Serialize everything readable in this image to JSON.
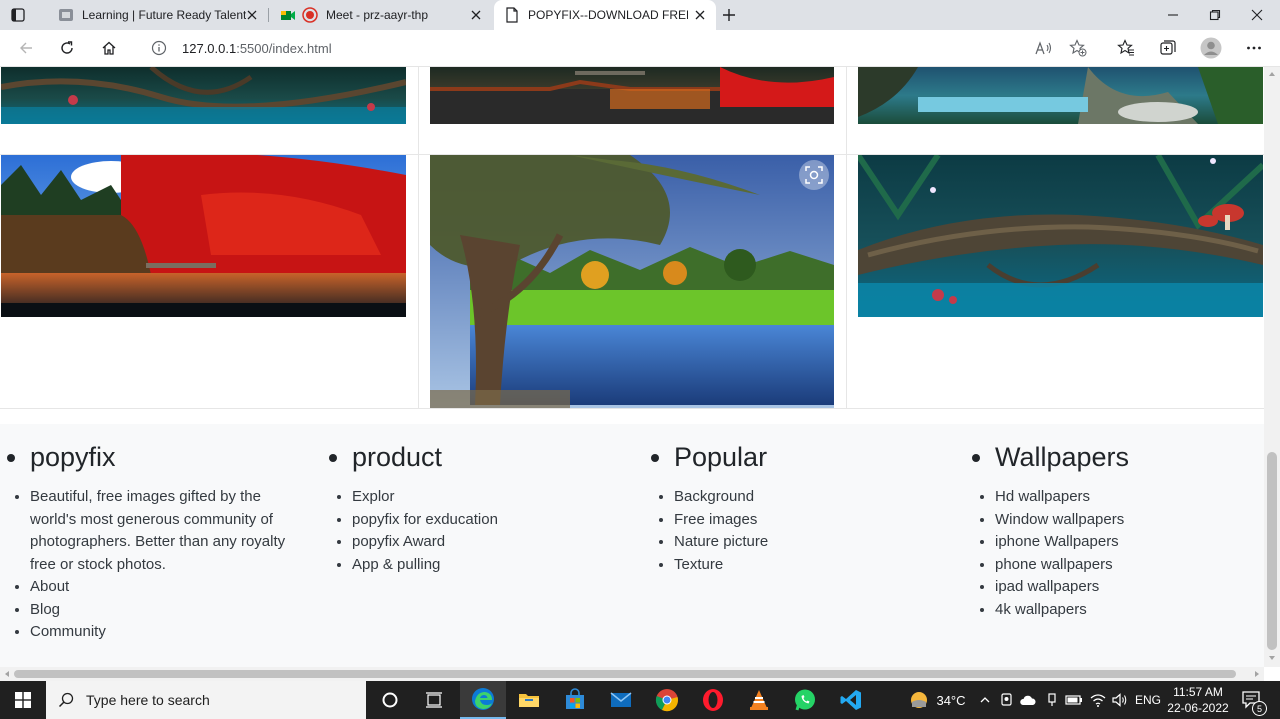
{
  "browser": {
    "tabs": [
      {
        "title": "Learning | Future Ready Talent",
        "active": false
      },
      {
        "title": "Meet - prz-aayr-thp",
        "active": false
      },
      {
        "title": "POPYFIX--DOWNLOAD FREE WA",
        "active": true
      }
    ],
    "url_host": "127.0.0.1",
    "url_path": ":5500/index.html"
  },
  "footer": {
    "columns": [
      {
        "heading": "popyfix",
        "items": [
          "Beautiful, free images gifted by the world's most generous community of photographers. Better than any royalty free or stock photos.",
          "About",
          "Blog",
          "Community"
        ]
      },
      {
        "heading": "product",
        "items": [
          "Explor",
          "popyfix for exducation",
          "popyfix Award",
          "App & pulling"
        ]
      },
      {
        "heading": "Popular",
        "items": [
          "Background",
          "Free images",
          "Nature picture",
          "Texture"
        ]
      },
      {
        "heading": "Wallpapers",
        "items": [
          "Hd wallpapers",
          "Window wallpapers",
          "iphone Wallpapers",
          "phone wallpapers",
          "ipad wallpapers",
          "4k wallpapers"
        ]
      }
    ]
  },
  "taskbar": {
    "search_placeholder": "Type here to search",
    "weather": "34°C",
    "language": "ENG",
    "time": "11:57 AM",
    "date": "22-06-2022",
    "notification_count": "5"
  }
}
